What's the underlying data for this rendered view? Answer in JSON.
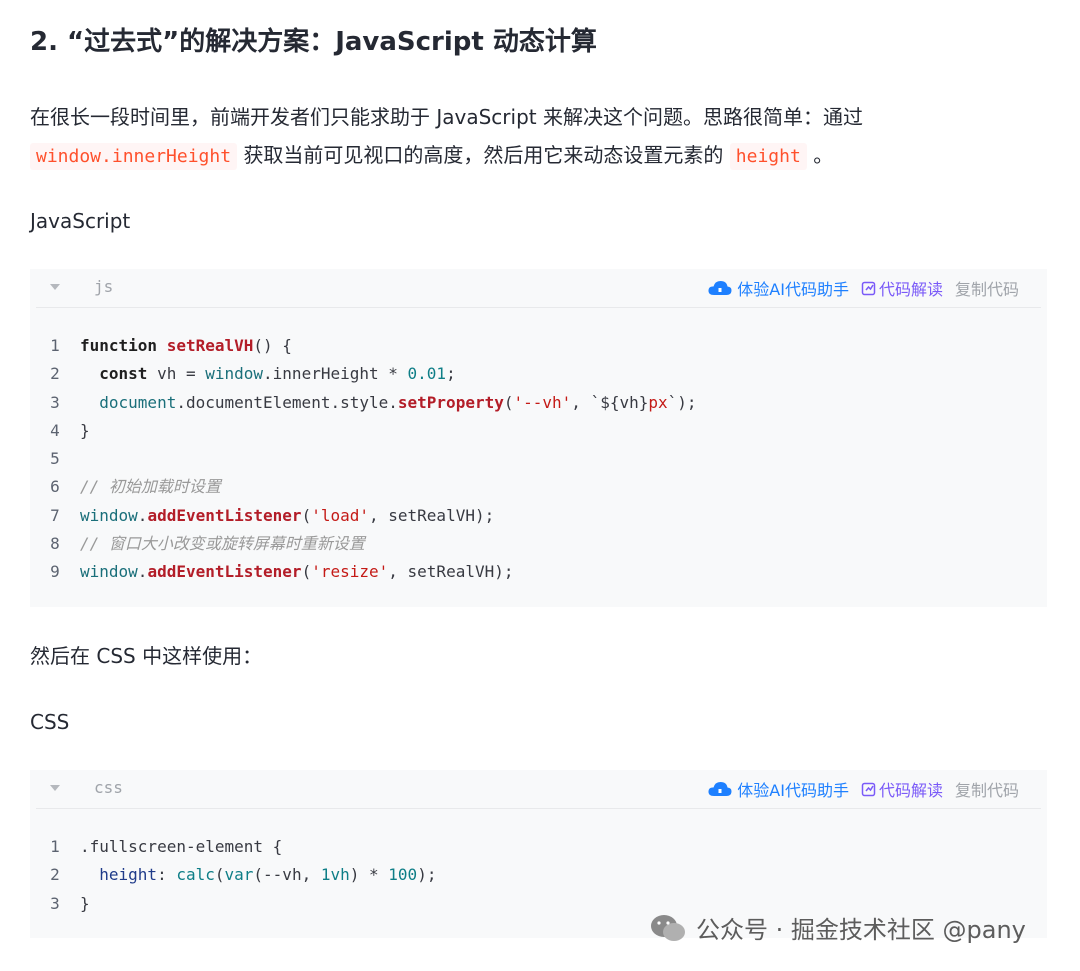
{
  "heading": "2. “过去式”的解决方案：JavaScript 动态计算",
  "para1": {
    "text_a": "在很长一段时间里，前端开发者们只能求助于 JavaScript 来解决这个问题。思路很简单：通过",
    "code_a": "window.innerHeight",
    "text_b": "获取当前可见视口的高度，然后用它来动态设置元素的",
    "code_b": "height",
    "text_c": "。"
  },
  "label_js": "JavaScript",
  "codeblock_js": {
    "lang": "js",
    "ai_label": "体验AI代码助手",
    "read_label": "代码解读",
    "copy_label": "复制代码",
    "line_numbers": [
      "1",
      "2",
      "3",
      "4",
      "5",
      "6",
      "7",
      "8",
      "9"
    ],
    "lines": {
      "l1_kw": "function",
      "l1_fn": "setRealVH",
      "l1_rest": "() {",
      "l2_kw": "const",
      "l2_a": " vh = ",
      "l2_obj": "window",
      "l2_b": ".innerHeight * ",
      "l2_num": "0.01",
      "l2_c": ";",
      "l3_obj": "document",
      "l3_a": ".documentElement.style.",
      "l3_fn": "setProperty",
      "l3_b": "(",
      "l3_str": "'--vh'",
      "l3_c": ", `${vh}",
      "l3_str2": "px",
      "l3_d": "`);",
      "l4": "}",
      "l6_comment": "// 初始加载时设置",
      "l7_obj": "window",
      "l7_a": ".",
      "l7_fn": "addEventListener",
      "l7_b": "(",
      "l7_str": "'load'",
      "l7_c": ", setRealVH);",
      "l8_comment": "// 窗口大小改变或旋转屏幕时重新设置",
      "l9_obj": "window",
      "l9_a": ".",
      "l9_fn": "addEventListener",
      "l9_b": "(",
      "l9_str": "'resize'",
      "l9_c": ", setRealVH);"
    }
  },
  "para2": "然后在 CSS 中这样使用：",
  "label_css": "CSS",
  "codeblock_css": {
    "lang": "css",
    "ai_label": "体验AI代码助手",
    "read_label": "代码解读",
    "copy_label": "复制代码",
    "line_numbers": [
      "1",
      "2",
      "3"
    ],
    "lines": {
      "l1": ".fullscreen-element {",
      "l2_prop": "height",
      "l2_a": ": ",
      "l2_fn1": "calc",
      "l2_b": "(",
      "l2_fn2": "var",
      "l2_c": "(--vh, ",
      "l2_num1": "1vh",
      "l2_d": ") * ",
      "l2_num2": "100",
      "l2_e": ");",
      "l3": "}"
    }
  },
  "watermark": "公众号 · 掘金技术社区 @pany"
}
